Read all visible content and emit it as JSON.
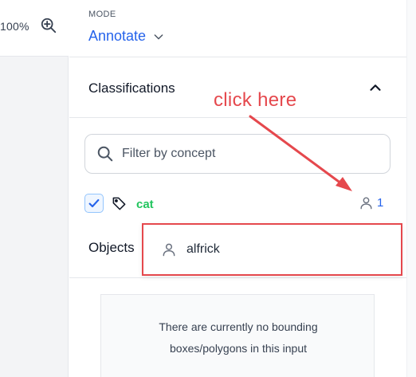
{
  "canvas": {
    "zoom_level": "100%",
    "zoom_in_icon": "zoom-in-icon"
  },
  "panel": {
    "mode_label": "MODE",
    "mode_value": "Annotate",
    "classifications_title": "Classifications",
    "filter_placeholder": "Filter by concept",
    "concept": {
      "name": "cat",
      "checked": true,
      "annotator_count": "1"
    },
    "objects_title": "Objects",
    "objects_empty_line1": "There are currently no bounding",
    "objects_empty_line2": "boxes/polygons in this input"
  },
  "popover": {
    "annotator_name": "alfrick"
  },
  "annotation": {
    "callout_text": "click here"
  },
  "colors": {
    "accent": "#2563eb",
    "concept": "#22c55e",
    "highlight": "#e5484d"
  }
}
